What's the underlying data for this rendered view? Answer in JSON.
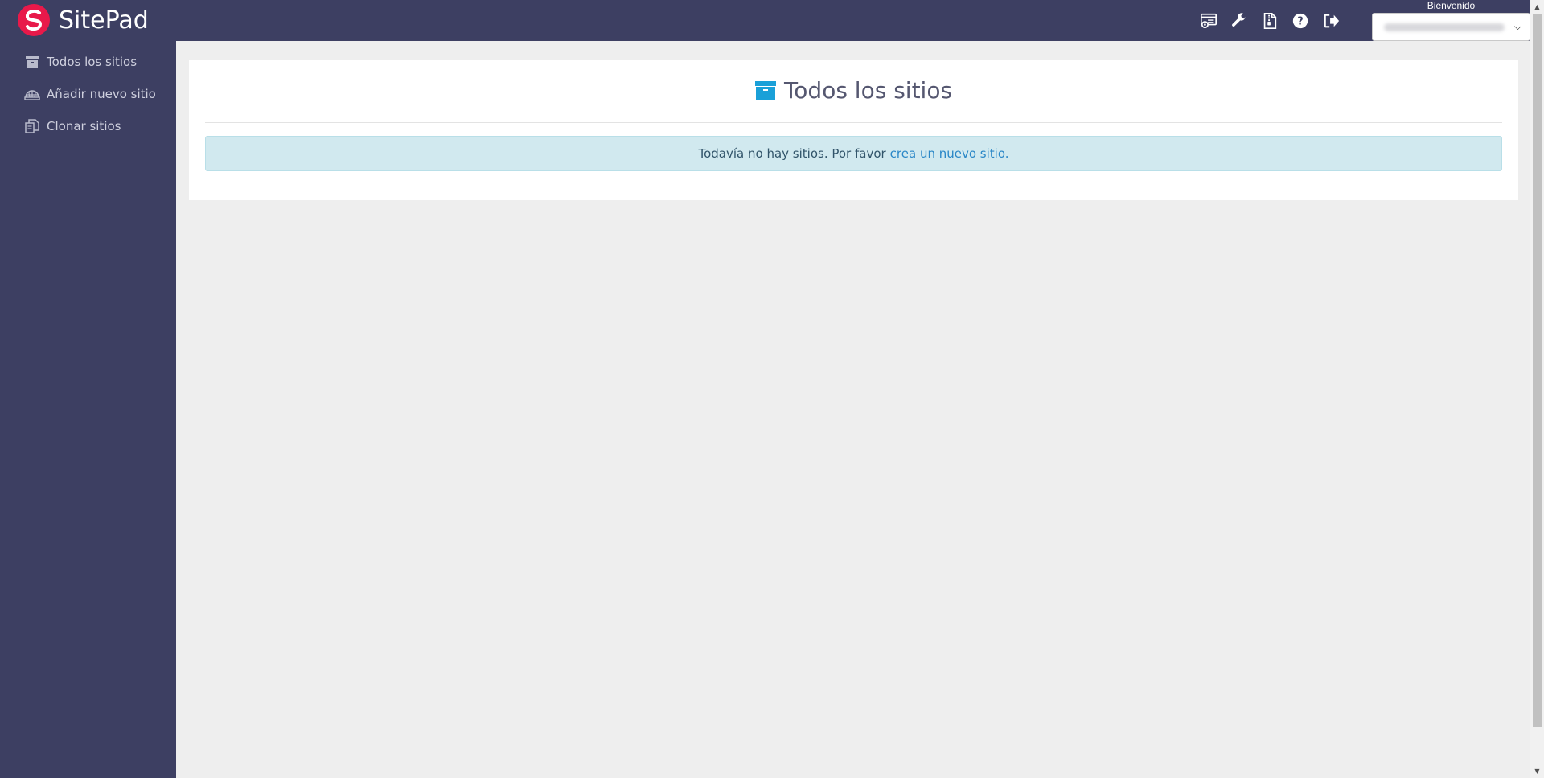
{
  "app": {
    "name": "SitePad"
  },
  "header": {
    "icons": [
      "website-settings-icon",
      "wrench-icon",
      "file-archive-icon",
      "help-icon",
      "logout-icon"
    ],
    "welcome_label": "Bienvenido",
    "user_select": {
      "value_obscured": true
    }
  },
  "sidebar": {
    "items": [
      {
        "label": "Todos los sitios",
        "icon": "archive-icon"
      },
      {
        "label": "Añadir nuevo sitio",
        "icon": "globe-icon"
      },
      {
        "label": "Clonar sitios",
        "icon": "clone-icon"
      }
    ]
  },
  "main": {
    "title": "Todos los sitios",
    "alert": {
      "text": "Todavía no hay sitios. Por favor",
      "link_text": "crea un nuevo sitio."
    }
  },
  "colors": {
    "navbar": "#3d3f62",
    "logo": "#e8194a",
    "accent": "#1aa0d8",
    "alert_bg": "#d1e9ef",
    "link": "#2a87c7"
  }
}
